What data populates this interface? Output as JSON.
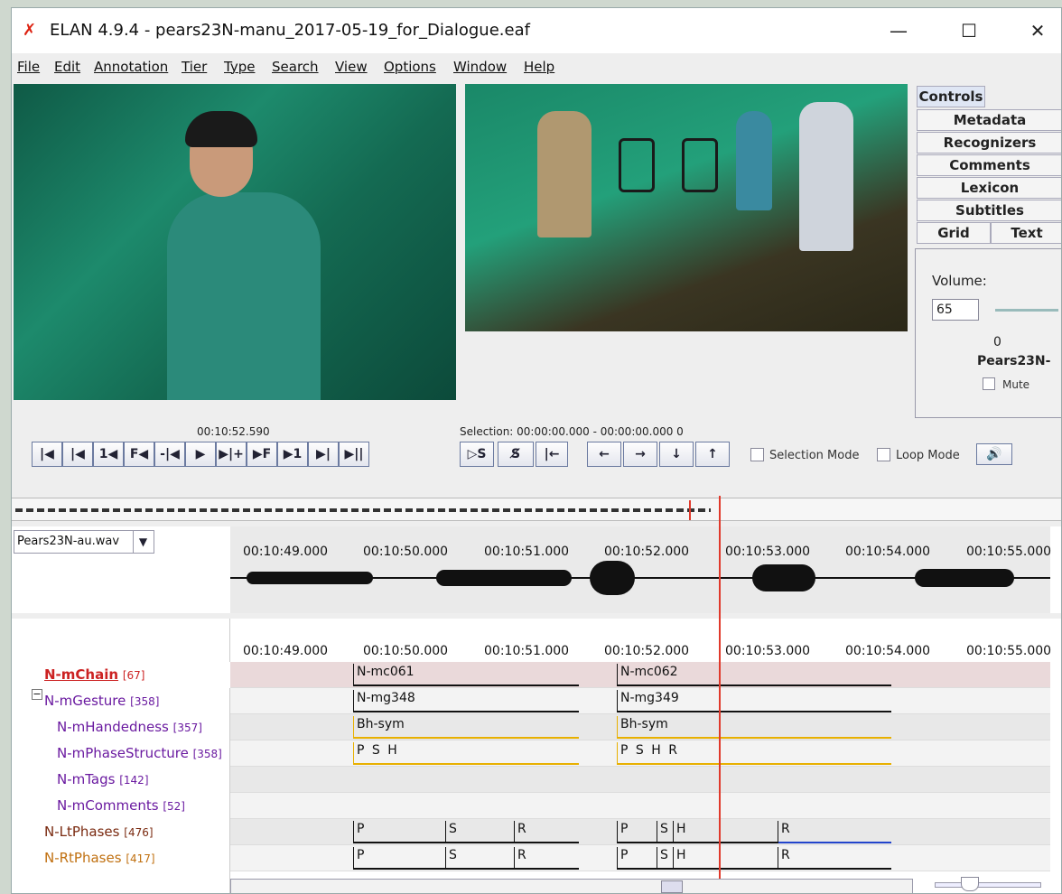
{
  "window": {
    "title": "ELAN 4.9.4 - pears23N-manu_2017-05-19_for_Dialogue.eaf",
    "min": "—",
    "max": "☐",
    "close": "✕"
  },
  "menu": [
    "File",
    "Edit",
    "Annotation",
    "Tier",
    "Type",
    "Search",
    "View",
    "Options",
    "Window",
    "Help"
  ],
  "side_tabs": [
    "Controls",
    "Metadata",
    "Recognizers",
    "Comments",
    "Lexicon",
    "Subtitles",
    "Grid",
    "Text"
  ],
  "controls": {
    "volume_label": "Volume:",
    "volume_value": "65",
    "zero": "0",
    "player_name": "Pears23N-",
    "mute": "Mute"
  },
  "playback": {
    "time": "00:10:52.590",
    "selection": "Selection: 00:00:00.000 - 00:00:00.000 0",
    "buttons": [
      "|◀",
      "|◀",
      "1◀",
      "F◀",
      "-|◀",
      "▶",
      "▶|+",
      "▶F",
      "▶1",
      "▶|",
      "▶||"
    ],
    "sel_buttons": [
      "▷S",
      "S̸",
      "|←"
    ],
    "arrows": [
      "←",
      "→",
      "↓",
      "↑"
    ],
    "selection_mode": "Selection Mode",
    "loop_mode": "Loop Mode"
  },
  "wave": {
    "file": "Pears23N-au.wav",
    "ticks": [
      "00:10:49.000",
      "00:10:50.000",
      "00:10:51.000",
      "00:10:52.000",
      "00:10:53.000",
      "00:10:54.000",
      "00:10:55.000"
    ]
  },
  "tiers": [
    {
      "name": "N-mChain",
      "count": "[67]",
      "color": "#cc2222",
      "indent": 0
    },
    {
      "name": "N-mGesture",
      "count": "[358]",
      "color": "#6a1aa0",
      "indent": 0
    },
    {
      "name": "N-mHandedness",
      "count": "[357]",
      "color": "#6a1aa0",
      "indent": 1
    },
    {
      "name": "N-mPhaseStructure",
      "count": "[358]",
      "color": "#6a1aa0",
      "indent": 1
    },
    {
      "name": "N-mTags",
      "count": "[142]",
      "color": "#6a1aa0",
      "indent": 1
    },
    {
      "name": "N-mComments",
      "count": "[52]",
      "color": "#6a1aa0",
      "indent": 1
    },
    {
      "name": "N-LtPhases",
      "count": "[476]",
      "color": "#7a2a10",
      "indent": 0
    },
    {
      "name": "N-RtPhases",
      "count": "[417]",
      "color": "#c07010",
      "indent": 0
    }
  ],
  "annotations": {
    "mchain": [
      "N-mc061",
      "N-mc062"
    ],
    "mgesture": [
      "N-mg348",
      "N-mg349"
    ],
    "handed": [
      "Bh-sym",
      "Bh-sym"
    ],
    "phase": [
      "P S H",
      "P S H R"
    ],
    "lt": [
      "P",
      "S",
      "R",
      "P",
      "S",
      "H",
      "R"
    ],
    "rt": [
      "P",
      "S",
      "R",
      "P",
      "S",
      "H",
      "R"
    ]
  }
}
